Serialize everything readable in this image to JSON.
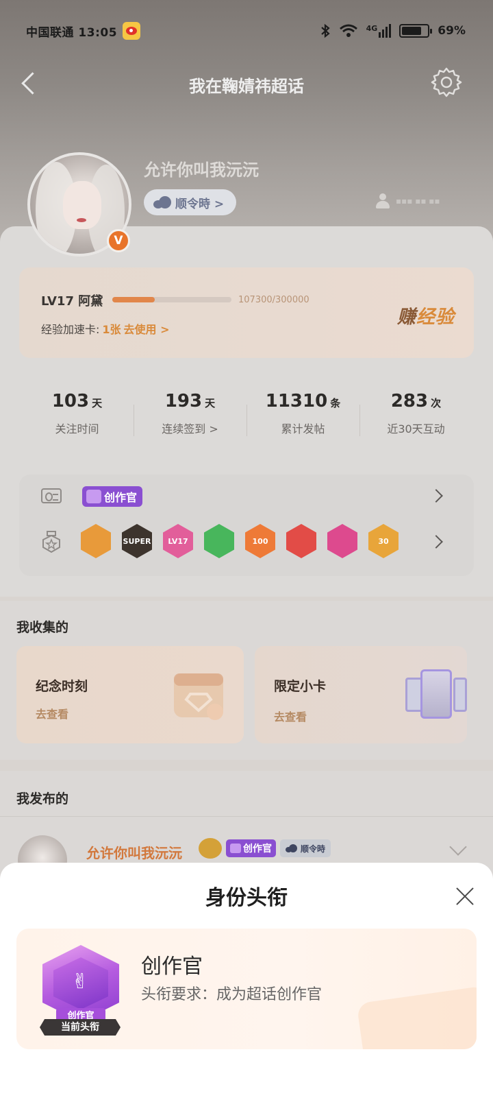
{
  "status_bar": {
    "carrier": "中国联通",
    "time": "13:05",
    "network": "4G",
    "battery": "69%"
  },
  "nav": {
    "title": "我在鞠婧祎超话"
  },
  "profile": {
    "username": "允许你叫我沅沅",
    "rank_chip": "顺令時 >",
    "verified_badge": "V",
    "follow_text": "▪▪▪ ▪▪ ▪▪"
  },
  "level": {
    "label": "LV17 阿黛",
    "progress_text": "107300/300000",
    "progress_fraction": 0.3577,
    "boost_label": "经验加速卡:",
    "boost_count": "1张",
    "boost_action": "去使用 >",
    "earn_dark": "赚",
    "earn_light": "经验"
  },
  "stats": [
    {
      "num": "103",
      "unit": "天",
      "label": "关注时间"
    },
    {
      "num": "193",
      "unit": "天",
      "label": "连续签到 >"
    },
    {
      "num": "11310",
      "unit": "条",
      "label": "累计发帖"
    },
    {
      "num": "283",
      "unit": "次",
      "label": "近30天互动"
    }
  ],
  "badges": {
    "creator_tag": "创作官",
    "medals": [
      {
        "name": "crown-medal",
        "label": "",
        "color": "#e89a3a"
      },
      {
        "name": "super-medal",
        "label": "SUPER",
        "color": "#3d342d"
      },
      {
        "name": "lv17-medal",
        "label": "LV17",
        "color": "#e25e9a"
      },
      {
        "name": "hand-medal",
        "label": "",
        "color": "#48b65c"
      },
      {
        "name": "100days-medal",
        "label": "100",
        "color": "#ee7a37"
      },
      {
        "name": "trophy-medal",
        "label": "",
        "color": "#e24c47"
      },
      {
        "name": "graduate-medal",
        "label": "",
        "color": "#dd4a8e"
      },
      {
        "name": "30days-medal",
        "label": "30",
        "color": "#e8a53a"
      }
    ]
  },
  "collected": {
    "title": "我收集的",
    "cards": [
      {
        "title": "纪念时刻",
        "sub": "去查看"
      },
      {
        "title": "限定小卡",
        "sub": "去查看"
      }
    ]
  },
  "posted": {
    "title": "我发布的",
    "author": "允许你叫我沅沅",
    "creator_tag": "创作官",
    "rank_tag": "顺令時"
  },
  "sheet": {
    "title": "身份头衔",
    "badge_name": "创作官",
    "badge_current": "当前头衔",
    "title_name": "创作官",
    "requirement": "头衔要求：成为超话创作官"
  }
}
